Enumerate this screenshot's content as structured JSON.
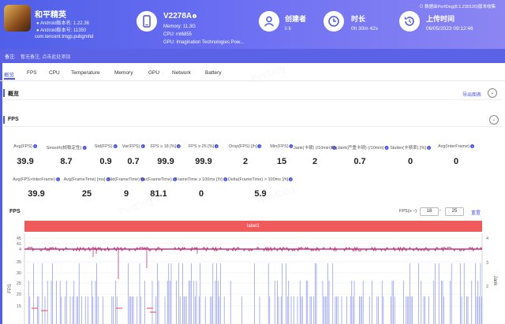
{
  "app": {
    "name": "和平精英",
    "android_version": "Android版本名: 1.22.36",
    "android_version_code": "Android版本号: 11350",
    "package": "com.tencent.tmgp.pubgmhd"
  },
  "device": {
    "name": "V2278A",
    "memory": "Memory: 11.3G",
    "cpu": "CPU: mt6855",
    "gpu": "GPU: Imagination Technologies Pow..."
  },
  "creator": {
    "label": "创建者",
    "value": "li li"
  },
  "duration": {
    "label": "时长",
    "value": "0h 30m 42s"
  },
  "upload": {
    "label": "上传时间",
    "value": "06/05/2023 09:12:46"
  },
  "upload_info": "数据由PerfDog(8.1.230120)版本收集",
  "notes": {
    "label": "备注:",
    "value": "暂无备注, 点击此处添加"
  },
  "tabs": [
    "概览",
    "FPS",
    "CPU",
    "Temperature",
    "Memory",
    "GPU",
    "Network",
    "Battery"
  ],
  "overview": {
    "title": "概览",
    "export": "导出图表"
  },
  "fps_section": {
    "title": "FPS",
    "toggle": "⌄"
  },
  "metrics_row1": [
    {
      "label": "Avg(FPS)",
      "value": "39.9"
    },
    {
      "label": "Smooth(帧稳定性)",
      "value": "8.7"
    },
    {
      "label": "Std(FPS)",
      "value": "0.9"
    },
    {
      "label": "Var(FPS)",
      "value": "0.7"
    },
    {
      "label": "FPS ≥ 18 [%]",
      "value": "99.9"
    },
    {
      "label": "FPS ≥ 25 [%]",
      "value": "99.9"
    },
    {
      "label": "Drop(FPS) [/h]",
      "value": "2"
    },
    {
      "label": "Min(FPS)",
      "value": "15"
    },
    {
      "label": "Jank(卡顿) (/10min)",
      "value": "2"
    },
    {
      "label": "BigJank(严重卡顿) (/10min)",
      "value": "0.7"
    },
    {
      "label": "Stutter(卡顿率) [%]",
      "value": "0"
    },
    {
      "label": "Avg(InterFrame)",
      "value": "0"
    }
  ],
  "metrics_row2": [
    {
      "label": "Avg(FPS>InterFrame)",
      "value": "39.9"
    },
    {
      "label": "Avg(FrameTime) [ms]",
      "value": "25"
    },
    {
      "label": "Std(FrameTime)",
      "value": "9"
    },
    {
      "label": "Var(FrameTime)",
      "value": "81.1"
    },
    {
      "label": "FrameTime ≥ 100ms [/h]",
      "value": "0"
    },
    {
      "label": "Delta(FrameTime) > 100ms [/h]",
      "value": "5.9"
    }
  ],
  "fps_chart": {
    "title": "FPS",
    "range_label": "FPS(≥ ~)",
    "range_min": "18",
    "range_max": "25",
    "reset": "重置",
    "label_bar": "label1",
    "y_left_ticks": [
      "45",
      "41",
      "4",
      "35",
      "30",
      "25",
      "20",
      "15"
    ],
    "y_left_label": "FPS",
    "y_right_ticks": [
      "4",
      "3",
      "2"
    ],
    "y_right_label": "Jank",
    "fps_color": "#c0357f",
    "bar_color": "#5563e6",
    "jank_color": "#f06060"
  },
  "watermark": "PerfDog",
  "colors": {
    "accent": "#4a56e0",
    "header_start": "#4f5fe8",
    "header_end": "#8c86f3"
  }
}
